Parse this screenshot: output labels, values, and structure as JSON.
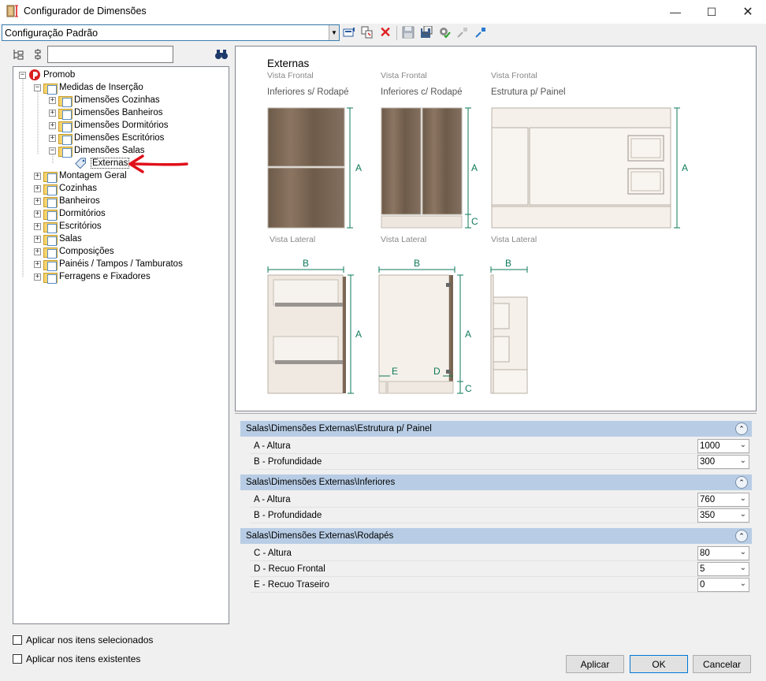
{
  "window": {
    "title": "Configurador de Dimensões"
  },
  "toolbar": {
    "config_value": "Configuração Padrão"
  },
  "tree": {
    "nodes": [
      {
        "label": "Promob"
      },
      {
        "label": "Medidas de Inserção"
      },
      {
        "label": "Dimensões Cozinhas"
      },
      {
        "label": "Dimensões Banheiros"
      },
      {
        "label": "Dimensões Dormitórios"
      },
      {
        "label": "Dimensões Escritórios"
      },
      {
        "label": "Dimensões Salas"
      },
      {
        "label": "Externas"
      },
      {
        "label": "Montagem Geral"
      },
      {
        "label": "Cozinhas"
      },
      {
        "label": "Banheiros"
      },
      {
        "label": "Dormitórios"
      },
      {
        "label": "Escritórios"
      },
      {
        "label": "Salas"
      },
      {
        "label": "Composições"
      },
      {
        "label": "Painéis / Tampos / Tamburatos"
      },
      {
        "label": "Ferragens e Fixadores"
      }
    ]
  },
  "preview": {
    "title": "Externas",
    "view_front": "Vista Frontal",
    "view_side": "Vista Lateral",
    "panel1": "Inferiores s/ Rodapé",
    "panel2": "Inferiores c/ Rodapé",
    "panel3": "Estrutura p/ Painel",
    "dim_a": "A",
    "dim_b": "B",
    "dim_c": "C",
    "dim_d": "D",
    "dim_e": "E"
  },
  "properties": {
    "sections": [
      {
        "title": "Salas\\Dimensões Externas\\Estrutura p/ Painel",
        "rows": [
          {
            "label": "A - Altura",
            "value": "1000"
          },
          {
            "label": "B - Profundidade",
            "value": "300"
          }
        ]
      },
      {
        "title": "Salas\\Dimensões Externas\\Inferiores",
        "rows": [
          {
            "label": "A - Altura",
            "value": "760"
          },
          {
            "label": "B - Profundidade",
            "value": "350"
          }
        ]
      },
      {
        "title": "Salas\\Dimensões Externas\\Rodapés",
        "rows": [
          {
            "label": "C - Altura",
            "value": "80"
          },
          {
            "label": "D - Recuo Frontal",
            "value": "5"
          },
          {
            "label": "E - Recuo Traseiro",
            "value": "0"
          }
        ]
      }
    ]
  },
  "footer": {
    "apply_selected": "Aplicar nos itens selecionados",
    "apply_existing": "Aplicar nos itens existentes",
    "apply_button": "Aplicar",
    "ok_button": "OK",
    "cancel_button": "Cancelar"
  },
  "colors": {
    "accent": "#3c7fb1",
    "section_header": "#b8cde5",
    "dimension_line": "#0e7a5a",
    "wood": "#7a6552",
    "annotation_arrow": "#e0101a"
  }
}
